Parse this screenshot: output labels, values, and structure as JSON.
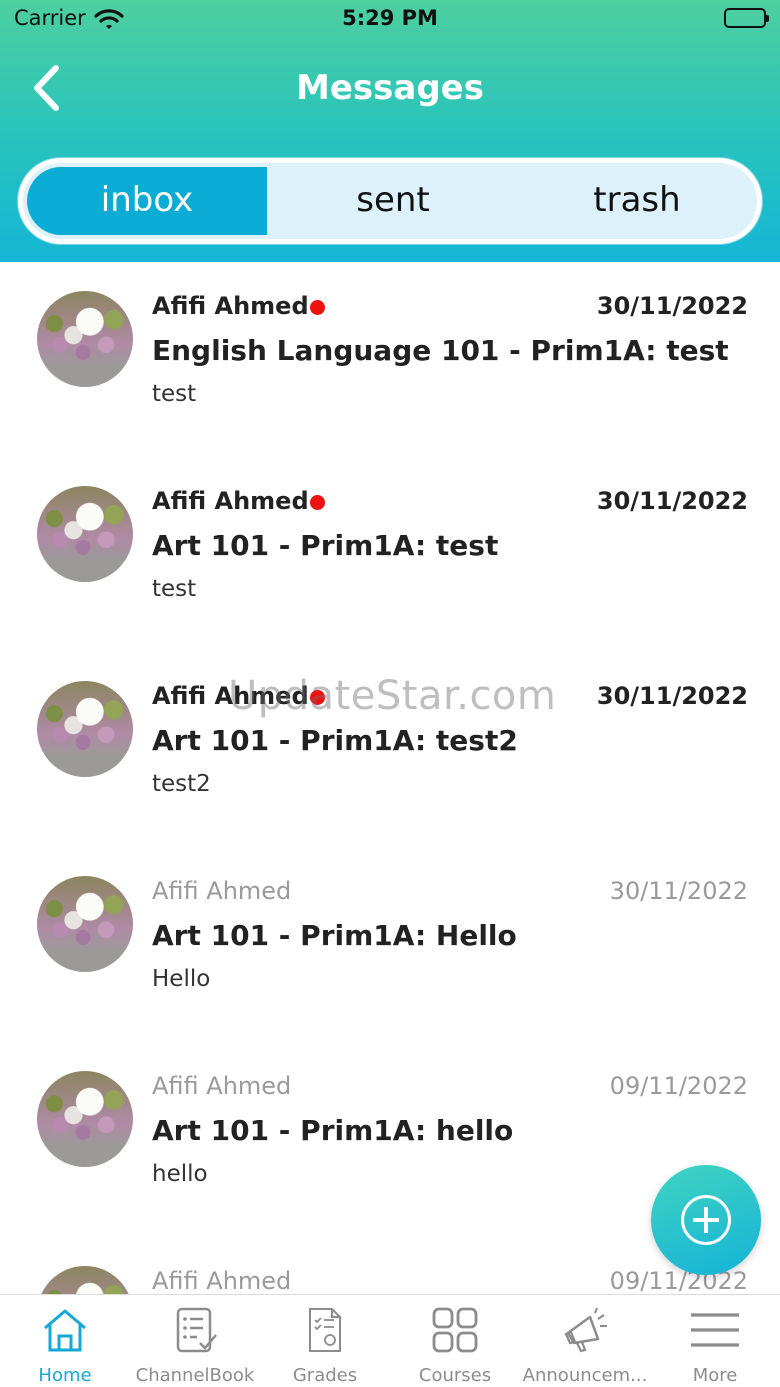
{
  "status_bar": {
    "carrier": "Carrier",
    "time": "5:29 PM"
  },
  "header": {
    "title": "Messages"
  },
  "segments": [
    {
      "label": "inbox",
      "active": true
    },
    {
      "label": "sent",
      "active": false
    },
    {
      "label": "trash",
      "active": false
    }
  ],
  "messages": [
    {
      "sender": "Afifi Ahmed",
      "date": "30/11/2022",
      "subject": "English Language 101 - Prim1A: test",
      "preview": "test",
      "unread": true
    },
    {
      "sender": "Afifi Ahmed",
      "date": "30/11/2022",
      "subject": "Art 101 - Prim1A: test",
      "preview": "test",
      "unread": true
    },
    {
      "sender": "Afifi Ahmed",
      "date": "30/11/2022",
      "subject": "Art 101 - Prim1A: test2",
      "preview": "test2",
      "unread": true
    },
    {
      "sender": "Afifi Ahmed",
      "date": "30/11/2022",
      "subject": "Art 101 - Prim1A: Hello",
      "preview": "Hello",
      "unread": false
    },
    {
      "sender": "Afifi Ahmed",
      "date": "09/11/2022",
      "subject": "Art 101 - Prim1A: hello",
      "preview": "hello",
      "unread": false
    },
    {
      "sender": "Afifi Ahmed",
      "date": "09/11/2022",
      "subject": "",
      "preview": "",
      "unread": false
    }
  ],
  "watermark": "UpdateStar.com",
  "tabbar": [
    {
      "label": "Home",
      "icon": "home-icon",
      "active": true
    },
    {
      "label": "ChannelBook",
      "icon": "checklist-icon",
      "active": false
    },
    {
      "label": "Grades",
      "icon": "grades-document-icon",
      "active": false
    },
    {
      "label": "Courses",
      "icon": "grid-icon",
      "active": false
    },
    {
      "label": "Announcem...",
      "icon": "megaphone-icon",
      "active": false
    },
    {
      "label": "More",
      "icon": "menu-icon",
      "active": false
    }
  ],
  "colors": {
    "accent": "#0aacd6",
    "unread_dot": "#ee1111",
    "header_top": "#4ecf9f",
    "header_bottom": "#15b6d6"
  }
}
